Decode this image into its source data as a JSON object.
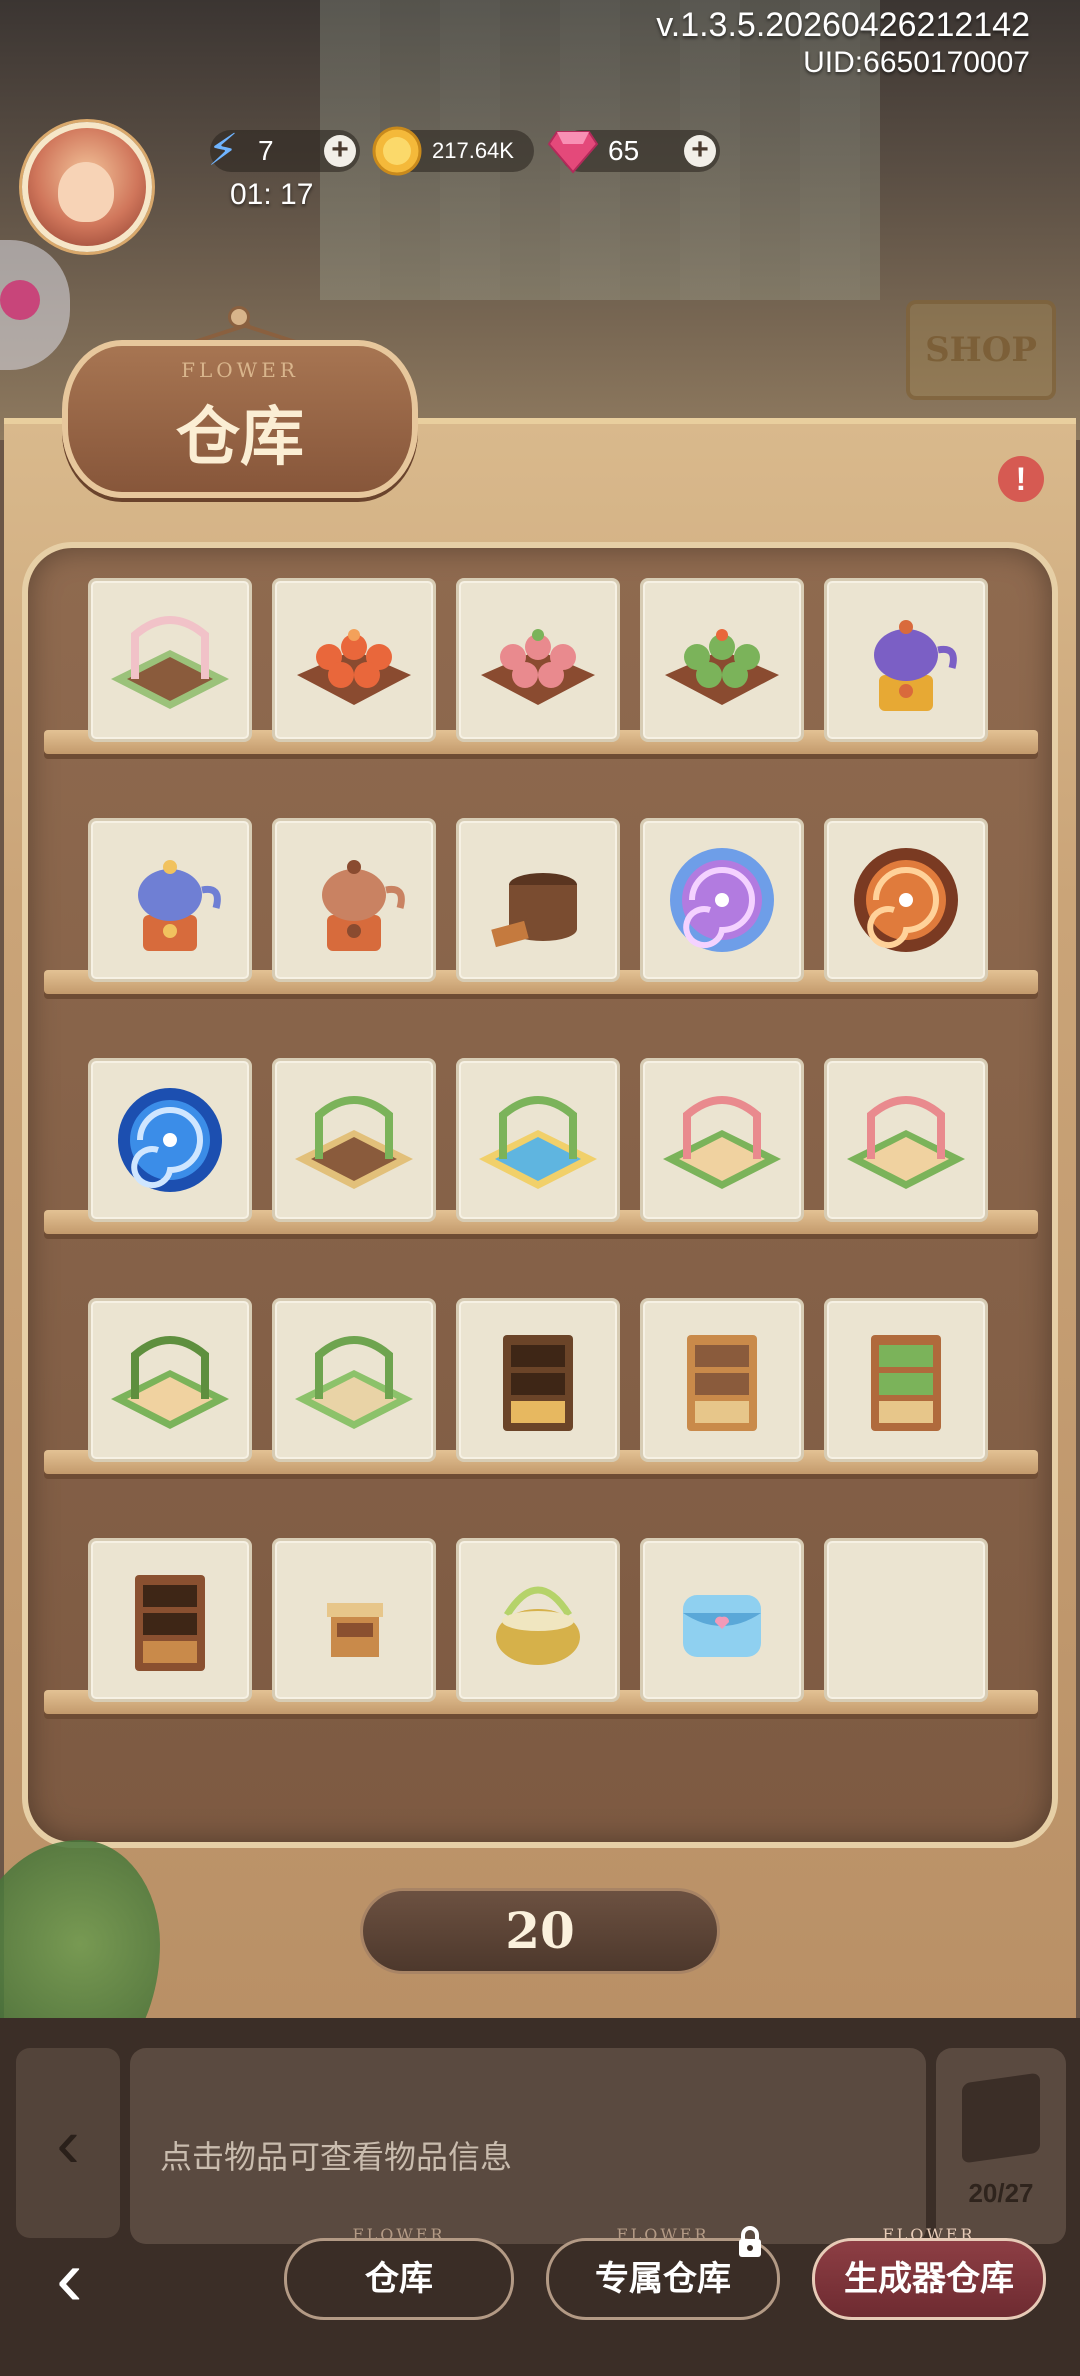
{
  "version": "v.1.3.5.20260426212142",
  "uid": "UID:6650170007",
  "resources": {
    "energy": {
      "value": "7",
      "icon": "lightning-icon"
    },
    "energy_timer": "01: 17",
    "coins": {
      "value": "217.64K",
      "icon": "clover-coin-icon"
    },
    "gems": {
      "value": "65",
      "icon": "ruby-gem-icon"
    }
  },
  "shop_sign": "SHOP",
  "title": {
    "small": "FLOWER",
    "main": "仓库"
  },
  "alert": "!",
  "shelves": [
    [
      {
        "name": "flower-garden-fence-item"
      },
      {
        "name": "orange-flower-bed-item"
      },
      {
        "name": "pink-flower-bed-item"
      },
      {
        "name": "sprout-flower-bed-item"
      },
      {
        "name": "purple-teapot-stove-item"
      }
    ],
    [
      {
        "name": "blue-teapot-stove-item"
      },
      {
        "name": "copper-teapot-stove-item"
      },
      {
        "name": "wooden-pot-item"
      },
      {
        "name": "purple-vortex-item"
      },
      {
        "name": "orange-vortex-item"
      }
    ],
    [
      {
        "name": "blue-vortex-item"
      },
      {
        "name": "wooden-cottage-item"
      },
      {
        "name": "pond-pavilion-item"
      },
      {
        "name": "flower-arch-item"
      },
      {
        "name": "green-arch-tile-item"
      }
    ],
    [
      {
        "name": "vine-pergola-item"
      },
      {
        "name": "grass-tile-item"
      },
      {
        "name": "dark-cupboard-item"
      },
      {
        "name": "cat-bookshelf-item"
      },
      {
        "name": "flower-cabinet-item"
      }
    ],
    [
      {
        "name": "small-cabinet-item"
      },
      {
        "name": "small-stool-item"
      },
      {
        "name": "picnic-basket-item"
      },
      {
        "name": "blue-pouch-item"
      },
      {
        "name": "empty-slot"
      }
    ]
  ],
  "count": "20",
  "info_text": "点击物品可查看物品信息",
  "capacity": "20/27",
  "nav": {
    "tab_small": "FLOWER",
    "warehouse": "仓库",
    "exclusive": "专属仓库",
    "generator": "生成器仓库"
  }
}
